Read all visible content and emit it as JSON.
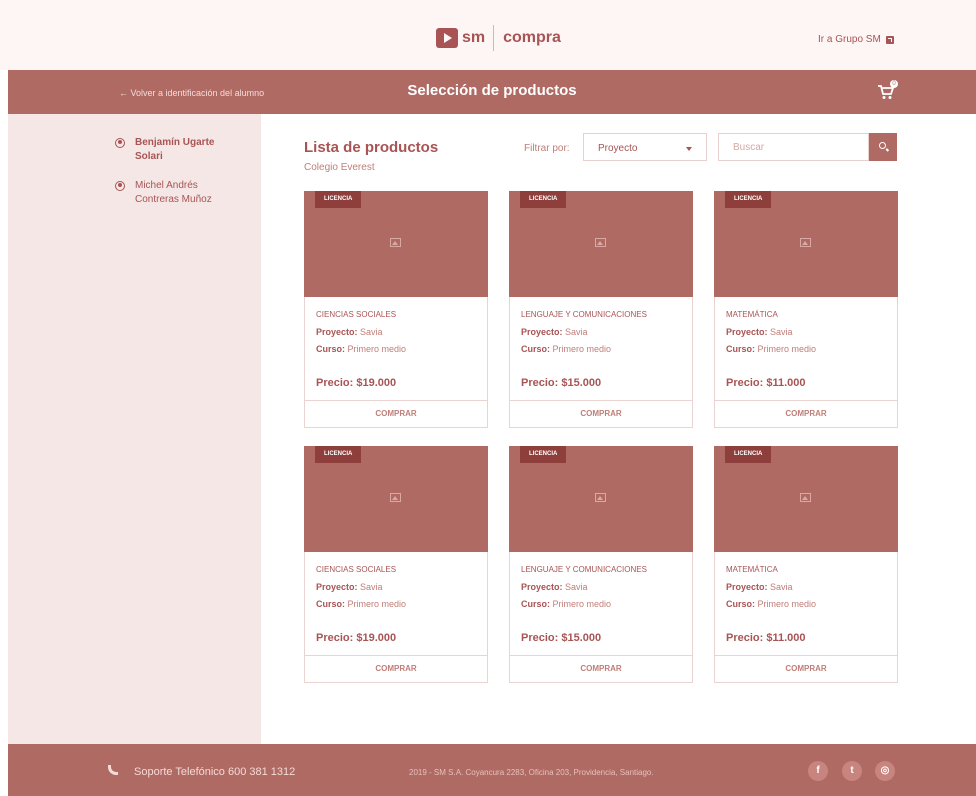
{
  "header": {
    "logo_sm": "sm",
    "logo_compra": "compra",
    "grupo_link": "Ir a Grupo SM"
  },
  "titlebar": {
    "back_link": "← Volver a identificación del alumno",
    "title": "Selección de productos",
    "cart_count": "0"
  },
  "sidebar": {
    "students": [
      {
        "name": "Benjamín Ugarte Solari",
        "active": true
      },
      {
        "name": "Michel Andrés Contreras Muñoz",
        "active": false
      }
    ]
  },
  "main": {
    "title": "Lista de productos",
    "school": "Colegio Everest",
    "filter_label": "Filtrar por:",
    "filter_value": "Proyecto",
    "search_placeholder": "Buscar"
  },
  "labels": {
    "project": "Proyecto:",
    "course": "Curso:",
    "buy": "COMPRAR"
  },
  "products": [
    {
      "tag": "LICENCIA",
      "subject": "CIENCIAS SOCIALES",
      "project": "Savia",
      "course": "Primero medio",
      "price": "Precio: $19.000"
    },
    {
      "tag": "LICENCIA",
      "subject": "LENGUAJE Y COMUNICACIONES",
      "project": "Savia",
      "course": "Primero medio",
      "price": "Precio: $15.000"
    },
    {
      "tag": "LICENCIA",
      "subject": "MATEMÁTICA",
      "project": "Savia",
      "course": "Primero medio",
      "price": "Precio: $11.000"
    },
    {
      "tag": "LICENCIA",
      "subject": "CIENCIAS SOCIALES",
      "project": "Savia",
      "course": "Primero medio",
      "price": "Precio: $19.000"
    },
    {
      "tag": "LICENCIA",
      "subject": "LENGUAJE Y COMUNICACIONES",
      "project": "Savia",
      "course": "Primero medio",
      "price": "Precio: $15.000"
    },
    {
      "tag": "LICENCIA",
      "subject": "MATEMÁTICA",
      "project": "Savia",
      "course": "Primero medio",
      "price": "Precio: $11.000"
    }
  ],
  "footer": {
    "support": "Soporte Telefónico 600 381 1312",
    "copyright": "2019 - SM S.A. Coyancura 2283, Oficina 203, Providencia, Santiago.",
    "social": [
      {
        "icon": "facebook-icon",
        "glyph": "f"
      },
      {
        "icon": "twitter-icon",
        "glyph": "t"
      },
      {
        "icon": "instagram-icon",
        "glyph": "◎"
      }
    ]
  },
  "colors": {
    "brand": "#b06a64",
    "text": "#a85454",
    "sidebar_bg": "#f4e7e6"
  }
}
